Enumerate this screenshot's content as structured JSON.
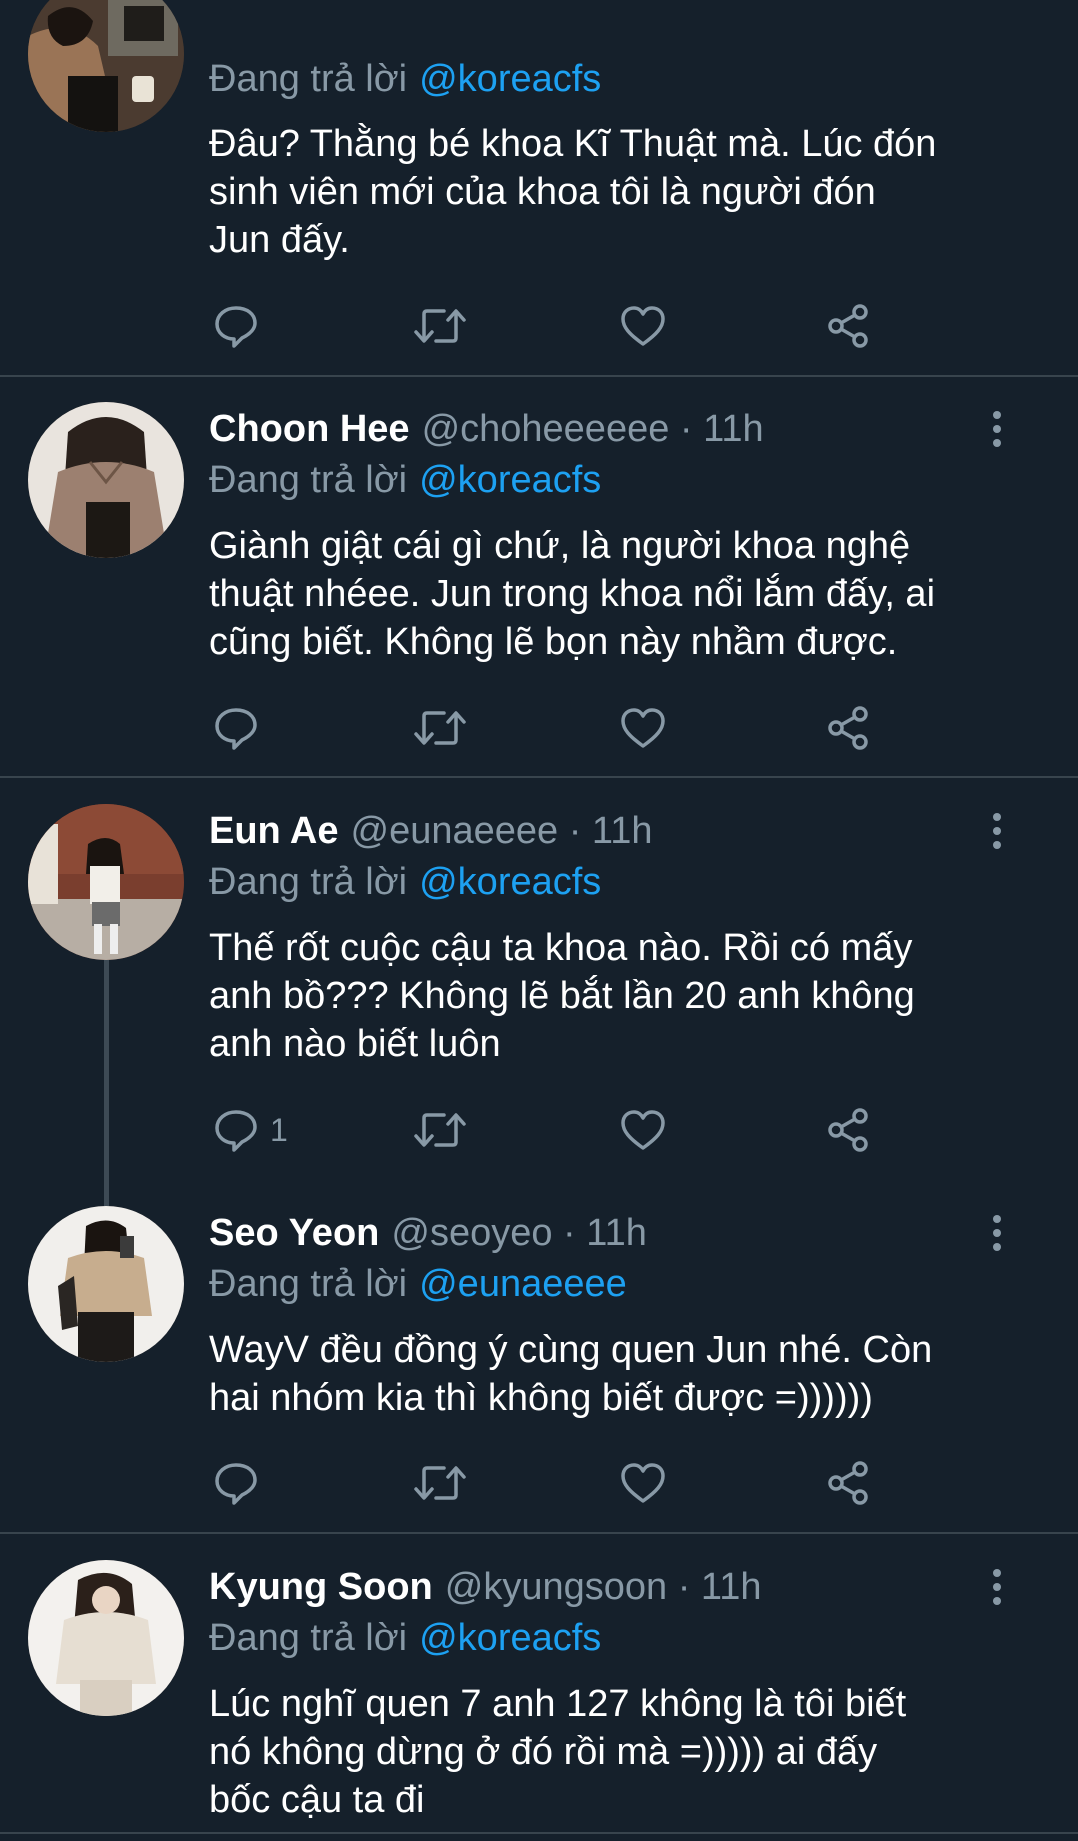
{
  "tweets": [
    {
      "name": "",
      "handle": "",
      "replying_label": "Đang trả lời",
      "replying_to": "@koreacfs",
      "lines": [
        "Đâu? Thằng bé khoa Kĩ Thuật mà. Lúc đón",
        "sinh viên mới của khoa tôi là người đón",
        "Jun đấy."
      ],
      "reply_count": ""
    },
    {
      "name": "Choon Hee",
      "handle": "@choheeeeee · 11h",
      "replying_label": "Đang trả lời",
      "replying_to": "@koreacfs",
      "lines": [
        "Giành giật cái gì chứ, là người khoa nghệ",
        "thuật nhéee. Jun trong khoa nổi lắm đấy, ai",
        "cũng biết. Không lẽ bọn này nhầm được."
      ],
      "reply_count": ""
    },
    {
      "name": "Eun Ae",
      "handle": "@eunaeeee · 11h",
      "replying_label": "Đang trả lời",
      "replying_to": "@koreacfs",
      "lines": [
        "Thế rốt cuộc cậu ta khoa nào. Rồi có mấy",
        "anh bồ??? Không lẽ bắt lần 20 anh không",
        "anh nào biết luôn"
      ],
      "reply_count": "1"
    },
    {
      "name": "Seo Yeon",
      "handle": "@seoyeo · 11h",
      "replying_label": "Đang trả lời",
      "replying_to": "@eunaeeee",
      "lines": [
        "WayV đều đồng ý cùng quen Jun nhé. Còn",
        "hai nhóm kia thì không biết được =))))))"
      ],
      "reply_count": ""
    },
    {
      "name": "Kyung Soon",
      "handle": "@kyungsoon · 11h",
      "replying_label": "Đang trả lời",
      "replying_to": "@koreacfs",
      "lines": [
        "Lúc nghĩ quen 7 anh 127 không là tôi biết",
        "nó không dừng ở đó rồi mà =))))) ai đấy",
        "bốc cậu ta đi"
      ],
      "reply_count": ""
    }
  ],
  "icons": {
    "reply": "reply-icon",
    "retweet": "retweet-icon",
    "like": "heart-icon",
    "share": "share-icon",
    "more": "more-vertical-icon"
  },
  "colors": {
    "background": "#15202b",
    "divider": "#38444d",
    "text": "#ffffff",
    "secondary": "#8899a6",
    "link": "#1da1f2"
  }
}
